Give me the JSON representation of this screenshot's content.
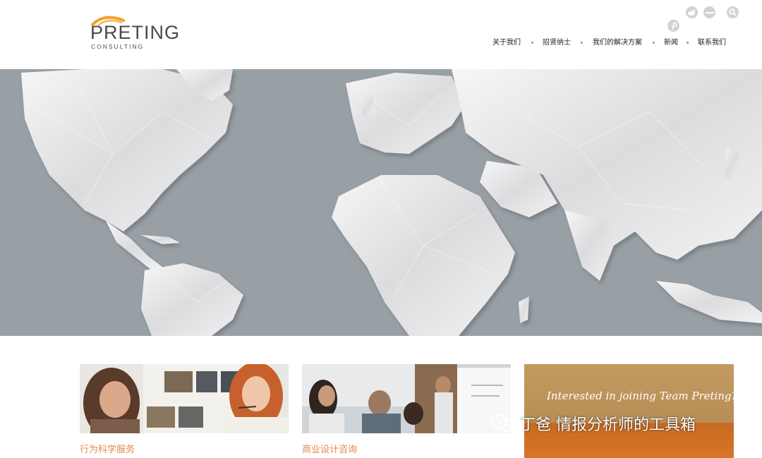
{
  "logo": {
    "main": "PRETING",
    "sub": "CONSULTING"
  },
  "social": [
    {
      "icon": "weibo-icon"
    },
    {
      "icon": "minus-icon"
    },
    {
      "icon": "search-icon"
    },
    {
      "icon": "pinterest-icon"
    }
  ],
  "nav": {
    "items": [
      {
        "label": "关于我们"
      },
      {
        "label": "招贤纳士"
      },
      {
        "label": "我们的解决方案"
      },
      {
        "label": "新闻"
      },
      {
        "label": "联系我们"
      }
    ]
  },
  "cards": [
    {
      "caption": "行为科学服务"
    },
    {
      "caption": "商业设计咨询"
    }
  ],
  "promo": {
    "text": "Interested in joining Team Preting?"
  },
  "watermark": {
    "text": "丁爸 情报分析师的工具箱"
  },
  "colors": {
    "accent": "#e8874a",
    "logo_arc": "#f0a02a",
    "hero_bg": "#98a0a6"
  }
}
